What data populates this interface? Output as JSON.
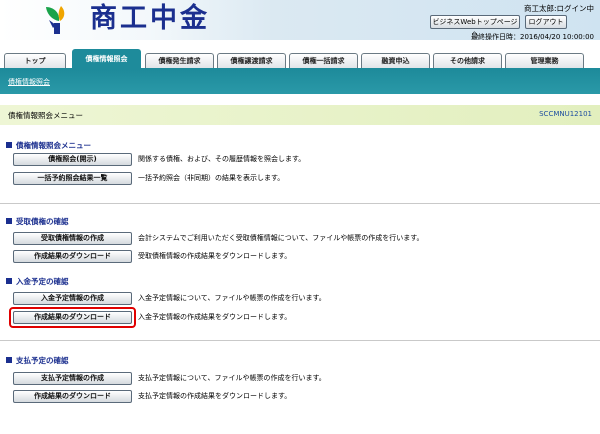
{
  "header": {
    "brand": "商工中金",
    "user": "商工太郎:ログイン中",
    "top_button": "ビジネスWebトップページへ",
    "logout_button": "ログアウト",
    "last_operation": "最終操作日時：2016/04/20 10:00:00"
  },
  "tabs": [
    {
      "label": "トップ"
    },
    {
      "label": "債権情報照会"
    },
    {
      "label": "債権発生請求"
    },
    {
      "label": "債権譲渡請求"
    },
    {
      "label": "債権一括請求"
    },
    {
      "label": "融資申込"
    },
    {
      "label": "その他請求"
    },
    {
      "label": "管理業務"
    }
  ],
  "active_tab": "債権情報照会",
  "subnav": {
    "link": "債権情報照会"
  },
  "page": {
    "title": "債権情報照会メニュー",
    "screen_id": "SCCMNU12101"
  },
  "sections": [
    {
      "title": "債権情報照会メニュー",
      "items": [
        {
          "button": "債権照会(開示)",
          "desc": "関係する債権、および、その履歴情報を照会します。"
        },
        {
          "button": "一括予約照会結果一覧",
          "desc": "一括予約照会（非同期）の結果を表示します。"
        }
      ]
    },
    {
      "title": "受取債権の確認",
      "items": [
        {
          "button": "受取債権情報の作成",
          "desc": "会計システムでご利用いただく受取債権情報について、ファイルや帳票の作成を行います。"
        },
        {
          "button": "作成結果のダウンロード",
          "desc": "受取債権情報の作成結果をダウンロードします。"
        }
      ]
    },
    {
      "title": "入金予定の確認",
      "items": [
        {
          "button": "入金予定情報の作成",
          "desc": "入金予定情報について、ファイルや帳票の作成を行います。"
        },
        {
          "button": "作成結果のダウンロード",
          "desc": "入金予定情報の作成結果をダウンロードします。"
        }
      ]
    },
    {
      "title": "支払予定の確認",
      "items": [
        {
          "button": "支払予定情報の作成",
          "desc": "支払予定情報について、ファイルや帳票の作成を行います。"
        },
        {
          "button": "作成結果のダウンロード",
          "desc": "支払予定情報の作成結果をダウンロードします。"
        }
      ]
    }
  ],
  "colors": {
    "brand": "#1b2f8f",
    "tab_active": "#1e8b9b",
    "highlight": "#e00000",
    "page_bar": "#e8f3c9"
  },
  "icons": {
    "logo": "shokochukin-logo-icon",
    "section": "square-bullet-icon"
  }
}
